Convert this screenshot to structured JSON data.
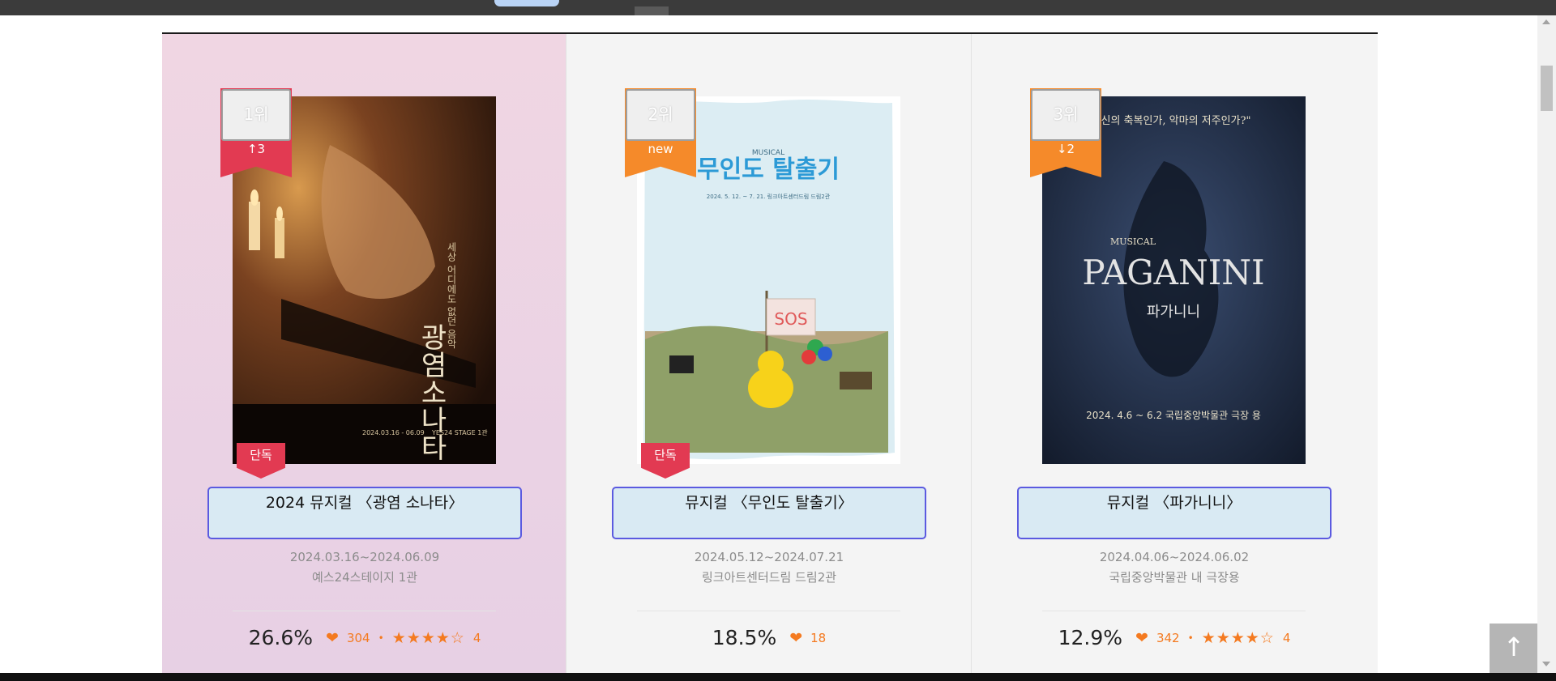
{
  "colors": {
    "accent_orange": "#f47a20",
    "rank_red": "#e23a52",
    "rank_orange": "#f58a2a",
    "title_border": "#5b5ae0",
    "title_bg": "#d9eaf3"
  },
  "scroll_top_button": {
    "icon": "arrow-up-icon",
    "label": "↑"
  },
  "cards": [
    {
      "rank": "1위",
      "change": "↑3",
      "ribbon_color": "#e23a52",
      "exclusive_label": "단독",
      "title": "2024 뮤지컬 〈광염 소나타〉",
      "dates": "2024.03.16~2024.06.09",
      "venue": "예스24스테이지 1관",
      "share": "26.6%",
      "likes": "304",
      "rating": "4",
      "stars": "★★★★☆",
      "poster": {
        "subtitle": "세상 어디에도 없던 음악",
        "title_vertical": "광염소나타",
        "date": "2024.03.16 - 06.09",
        "venue": "YES24 STAGE 1관"
      }
    },
    {
      "rank": "2위",
      "change": "new",
      "ribbon_color": "#f58a2a",
      "exclusive_label": "단독",
      "title": "뮤지컬 〈무인도 탈출기〉",
      "dates": "2024.05.12~2024.07.21",
      "venue": "링크아트센터드림 드림2관",
      "share": "18.5%",
      "likes": "18",
      "rating": "",
      "stars": "",
      "poster": {
        "top": "MUSICAL",
        "title": "무인도 탈출기",
        "date": "2024. 5. 12. ~ 7. 21. 링크아트센터드림 드림2관",
        "sign": "SOS"
      }
    },
    {
      "rank": "3위",
      "change": "↓2",
      "ribbon_color": "#f58a2a",
      "exclusive_label": "",
      "title": "뮤지컬 〈파가니니〉",
      "dates": "2024.04.06~2024.06.02",
      "venue": "국립중앙박물관 내 극장용",
      "share": "12.9%",
      "likes": "342",
      "rating": "4",
      "stars": "★★★★☆",
      "poster": {
        "quote": "\"신의 축복인가, 악마의 저주인가?\"",
        "top": "MUSICAL",
        "title": "PAGANINI",
        "title_ko": "파가니니",
        "date": "2024. 4.6 ~ 6.2 국립중앙박물관 극장 용"
      }
    }
  ]
}
